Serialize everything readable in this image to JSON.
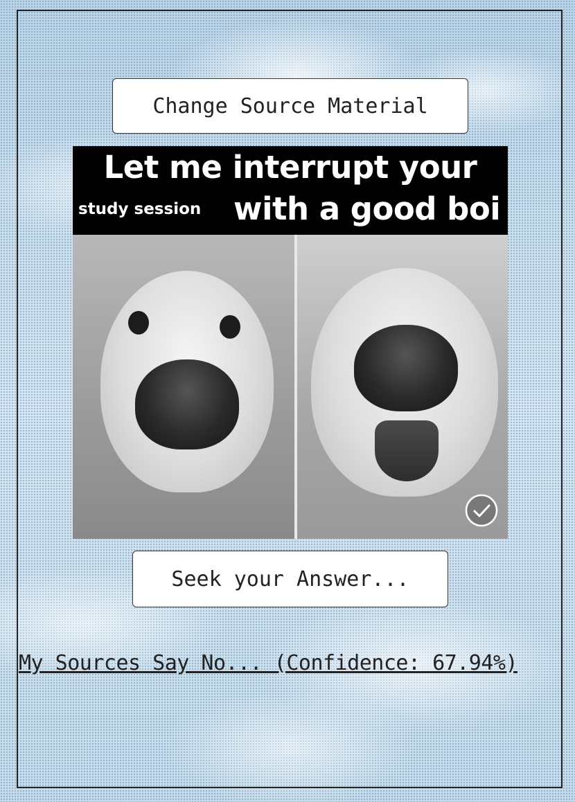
{
  "buttons": {
    "change_source": "Change Source Material",
    "seek_answer": "Seek your Answer..."
  },
  "meme": {
    "line1": "Let me interrupt your",
    "line2_small": "study session",
    "line2_large": "with a good boi"
  },
  "result": {
    "text": "My Sources Say No... (Confidence: 67.94%)"
  },
  "icons": {
    "selected_badge": "checkmark-circle-icon"
  },
  "colors": {
    "frame": "#222222",
    "button_bg": "#ffffff",
    "sky": "#cfe0ec"
  }
}
